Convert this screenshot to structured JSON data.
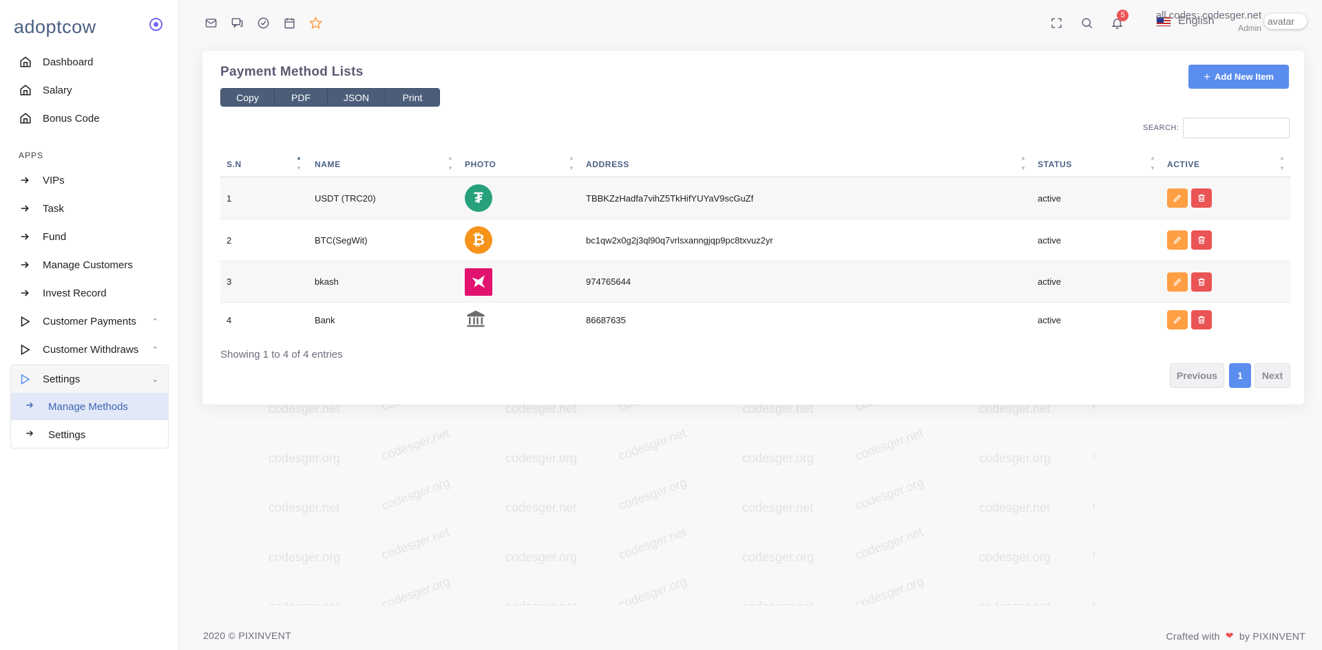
{
  "brand": "adoptcow",
  "sidebar": {
    "top_items": [
      {
        "label": "Dashboard"
      },
      {
        "label": "Salary"
      },
      {
        "label": "Bonus Code"
      }
    ],
    "apps_label": "APPS",
    "apps_items": [
      {
        "label": "VIPs"
      },
      {
        "label": "Task"
      },
      {
        "label": "Fund"
      },
      {
        "label": "Manage Customers"
      },
      {
        "label": "Invest Record"
      },
      {
        "label": "Customer Payments"
      },
      {
        "label": "Customer Withdraws"
      }
    ],
    "settings": {
      "label": "Settings",
      "children": [
        {
          "label": "Manage Methods"
        },
        {
          "label": "Settings"
        }
      ]
    }
  },
  "topbar": {
    "language": "English",
    "notification_count": "5",
    "user_name": "all codes: codesger.net",
    "user_role": "Admin",
    "avatar_alt": "avatar"
  },
  "card": {
    "title": "Payment Method Lists",
    "export_buttons": [
      "Copy",
      "PDF",
      "JSON",
      "Print"
    ],
    "add_button": "Add New Item",
    "search_label": "SEARCH:",
    "search_value": ""
  },
  "table": {
    "columns": [
      "S.N",
      "NAME",
      "PHOTO",
      "ADDRESS",
      "STATUS",
      "ACTIVE"
    ],
    "rows": [
      {
        "sn": "1",
        "name": "USDT (TRC20)",
        "photo": "tether-logo",
        "address": "TBBKZzHadfa7vihZ5TkHifYUYaV9scGuZf",
        "status": "active"
      },
      {
        "sn": "2",
        "name": "BTC(SegWit)",
        "photo": "bitcoin-logo",
        "address": "bc1qw2x0g2j3ql90q7vrlsxanngjqp9pc8txvuz2yr",
        "status": "active"
      },
      {
        "sn": "3",
        "name": "bkash",
        "photo": "bkash-logo",
        "address": "974765644",
        "status": "active"
      },
      {
        "sn": "4",
        "name": "Bank",
        "photo": "bank-icon",
        "address": "86687635",
        "status": "active"
      }
    ],
    "info": "Showing 1 to 4 of 4 entries",
    "pagination": {
      "previous": "Previous",
      "current": "1",
      "next": "Next"
    }
  },
  "footer": {
    "left": "2020 © PIXINVENT",
    "right_prefix": "Crafted with",
    "right_suffix": "by PIXINVENT"
  },
  "watermarks": [
    "codesger.org",
    "codesger.net"
  ],
  "colors": {
    "accent": "#5a8dee",
    "edit": "#ff9f43",
    "delete": "#ea5455",
    "tether": "#26a17b",
    "bitcoin": "#f7931a",
    "bkash": "#e2136e"
  }
}
